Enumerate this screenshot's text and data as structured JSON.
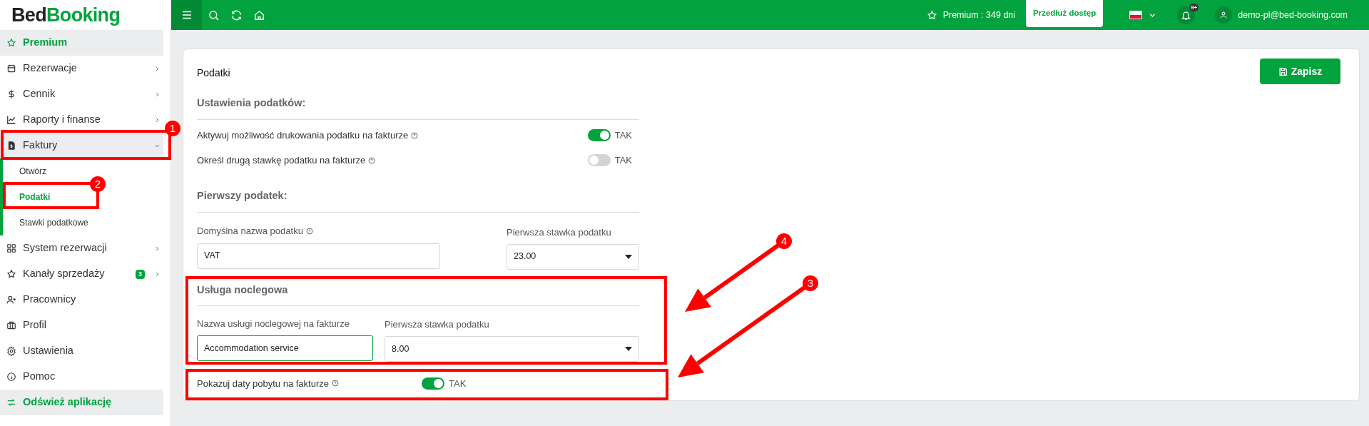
{
  "logo": {
    "part_1": "Bed",
    "part_2": "Booking"
  },
  "top_bar": {
    "premium": "Premium : 349 dni",
    "extend_button": "Przedłuż dostęp",
    "notifications_badge": "9+",
    "user_email": "demo-pl@bed-booking.com"
  },
  "sidebar": {
    "items": [
      {
        "label": "Premium",
        "kind": "highlight"
      },
      {
        "label": "Rezerwacje",
        "kind": "item",
        "expandable": true,
        "expanded": false
      },
      {
        "label": "Cennik",
        "kind": "item",
        "expandable": true,
        "expanded": false
      },
      {
        "label": "Raporty i finanse",
        "kind": "item",
        "expandable": true,
        "expanded": false
      },
      {
        "label": "Faktury",
        "kind": "item",
        "expandable": true,
        "expanded": true,
        "children": [
          {
            "label": "Otwórz",
            "selected": false
          },
          {
            "label": "Podatki",
            "selected": true
          },
          {
            "label": "Stawki podatkowe",
            "selected": false
          }
        ]
      },
      {
        "label": "System rezerwacji",
        "kind": "item",
        "expandable": true,
        "expanded": false
      },
      {
        "label": "Kanały sprzedaży",
        "kind": "item",
        "expandable": true,
        "expanded": false,
        "badge": "3"
      },
      {
        "label": "Pracownicy",
        "kind": "item",
        "expandable": false
      },
      {
        "label": "Profil",
        "kind": "item",
        "expandable": false
      },
      {
        "label": "Ustawienia",
        "kind": "item",
        "expandable": false
      },
      {
        "label": "Pomoc",
        "kind": "item",
        "expandable": false
      },
      {
        "label": "Odśwież aplikację",
        "kind": "highlight"
      }
    ]
  },
  "page": {
    "title": "Podatki",
    "save_button": "Zapisz",
    "tax_settings": {
      "heading": "Ustawienia podatków:",
      "toggles": [
        {
          "label": "Aktywuj możliwość drukowania podatku na fakturze",
          "on": true,
          "value_label": "TAK"
        },
        {
          "label": "Określ drugą stawkę podatku na fakturze",
          "on": false,
          "value_label": "TAK"
        }
      ]
    },
    "first_tax": {
      "heading": "Pierwszy podatek:",
      "name_field": {
        "label": "Domyślna nazwa podatku",
        "value": "VAT",
        "focused": false
      },
      "rate_select": {
        "label": "Pierwsza stawka podatku",
        "value": "23.00"
      }
    },
    "accommodation": {
      "heading": "Usługa noclegowa",
      "name_field": {
        "label": "Nazwa usługi noclegowej na fakturze",
        "value": "Accommodation service",
        "focused": true
      },
      "rate_select": {
        "label": "Pierwsza stawka podatku",
        "value": "8.00"
      },
      "show_dates": {
        "label": "Pokazuj daty pobytu na fakturze",
        "on": true,
        "value_label": "TAK"
      }
    }
  },
  "annotations": [
    {
      "number": "1"
    },
    {
      "number": "2"
    },
    {
      "number": "4"
    },
    {
      "number": "3"
    }
  ]
}
